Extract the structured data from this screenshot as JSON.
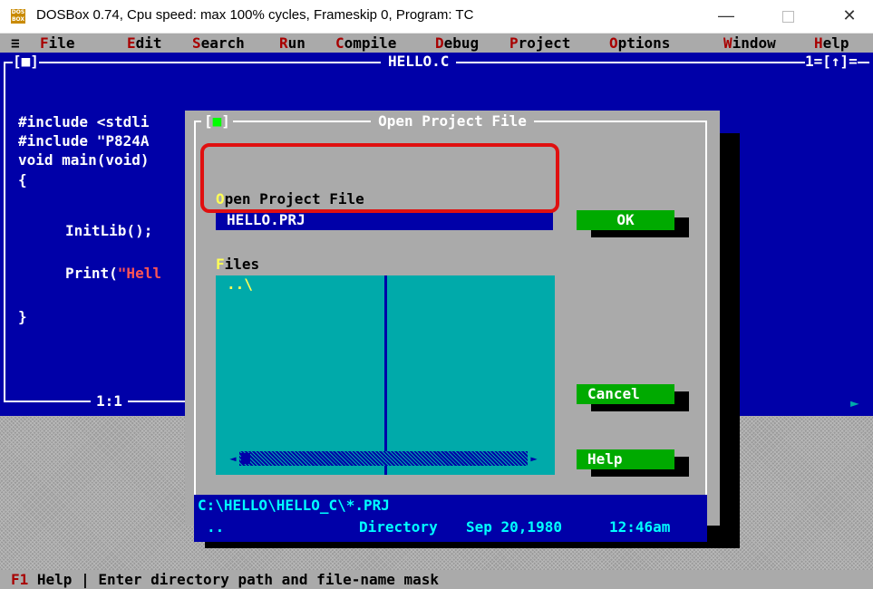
{
  "window": {
    "title": "DOSBox 0.74, Cpu speed: max 100% cycles, Frameskip  0, Program:    TC",
    "minimize": "—",
    "close": "✕"
  },
  "menubar": {
    "system": "≡",
    "items": [
      {
        "hot": "F",
        "rest": "ile"
      },
      {
        "hot": "E",
        "rest": "dit"
      },
      {
        "hot": "S",
        "rest": "earch"
      },
      {
        "hot": "R",
        "rest": "un"
      },
      {
        "hot": "C",
        "rest": "ompile"
      },
      {
        "hot": "D",
        "rest": "ebug"
      },
      {
        "hot": "P",
        "rest": "roject"
      },
      {
        "hot": "O",
        "rest": "ptions"
      },
      {
        "hot": "W",
        "rest": "indow"
      },
      {
        "hot": "H",
        "rest": "elp"
      }
    ]
  },
  "editor": {
    "title": "HELLO.C",
    "window_number": "1=[↑]=",
    "close_marker": "[■]",
    "cursor_position": "1:1",
    "lines": [
      "#include <stdli",
      "#include \"P824A",
      "void main(void)",
      "{",
      "InitLib();",
      "Print(",
      "\"Hell",
      "}"
    ]
  },
  "dialog": {
    "title": "Open Project File",
    "close_marker": "[■]",
    "input_label_hot": "O",
    "input_label_rest": "pen Project File",
    "input_value": "HELLO.PRJ",
    "files_label_hot": "F",
    "files_label_rest": "iles",
    "file_items": [
      "..\\"
    ],
    "buttons": {
      "ok": "OK",
      "cancel": "Cancel",
      "help": "Help"
    },
    "info": {
      "path": "C:\\HELLO\\HELLO_C\\*.PRJ",
      "name": "..",
      "type": "Directory",
      "date": "Sep 20,1980",
      "time": "12:46am"
    }
  },
  "statusbar": {
    "key": "F1",
    "key_label": "Help",
    "separator": "|",
    "message": "Enter directory path and file-name mask"
  },
  "colors": {
    "dos_blue": "#0000a8",
    "dos_gray": "#aaaaaa",
    "dos_cyan": "#00aaaa",
    "dos_green": "#00aa00",
    "highlight": "#e01010"
  }
}
